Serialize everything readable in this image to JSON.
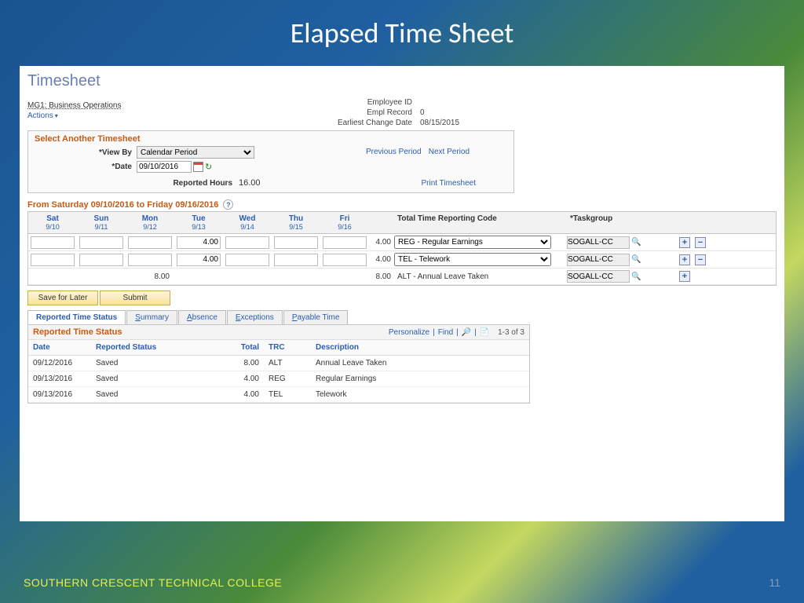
{
  "slide": {
    "title": "Elapsed Time Sheet",
    "org": "SOUTHERN CRESCENT TECHNICAL COLLEGE",
    "page": "11"
  },
  "app": {
    "title": "Timesheet",
    "employee_id_label": "Employee ID",
    "empl_record_label": "Empl Record",
    "empl_record": "0",
    "change_date_label": "Earliest Change Date",
    "change_date": "08/15/2015",
    "unit": "MG1: Business Operations",
    "actions": "Actions"
  },
  "select_panel": {
    "title": "Select Another Timesheet",
    "view_by_label": "*View By",
    "view_by": "Calendar Period",
    "date_label": "*Date",
    "date": "09/10/2016",
    "prev": "Previous Period",
    "next": "Next Period",
    "reported_hours_label": "Reported Hours",
    "reported_hours": "16.00",
    "print": "Print Timesheet"
  },
  "week": {
    "title": "From Saturday 09/10/2016 to Friday 09/16/2016",
    "days": [
      {
        "name": "Sat",
        "date": "9/10"
      },
      {
        "name": "Sun",
        "date": "9/11"
      },
      {
        "name": "Mon",
        "date": "9/12"
      },
      {
        "name": "Tue",
        "date": "9/13"
      },
      {
        "name": "Wed",
        "date": "9/14"
      },
      {
        "name": "Thu",
        "date": "9/15"
      },
      {
        "name": "Fri",
        "date": "9/16"
      }
    ],
    "trc_header": "Total Time Reporting Code",
    "tg_header": "*Taskgroup",
    "rows": [
      {
        "cells": [
          "",
          "",
          "",
          "4.00",
          "",
          "",
          ""
        ],
        "total": "4.00",
        "trc": "REG - Regular Earnings",
        "tg": "SOGALL-CC",
        "editable": true,
        "plus": true,
        "minus": true
      },
      {
        "cells": [
          "",
          "",
          "",
          "4.00",
          "",
          "",
          ""
        ],
        "total": "4.00",
        "trc": "TEL - Telework",
        "tg": "SOGALL-CC",
        "editable": true,
        "plus": true,
        "minus": true
      },
      {
        "cells": [
          "",
          "",
          "8.00",
          "",
          "",
          "",
          ""
        ],
        "total": "8.00",
        "trc": "ALT - Annual Leave Taken",
        "tg": "SOGALL-CC",
        "editable": false,
        "plus": true,
        "minus": false
      }
    ]
  },
  "buttons": {
    "save": "Save for Later",
    "submit": "Submit"
  },
  "tabs": {
    "items": [
      {
        "label": "Reported Time Status",
        "active": true
      },
      {
        "label": "Summary",
        "u": "S"
      },
      {
        "label": "Absence",
        "u": "A"
      },
      {
        "label": "Exceptions",
        "u": "E"
      },
      {
        "label": "Payable Time",
        "u": "P"
      }
    ]
  },
  "rts": {
    "title": "Reported Time Status",
    "personalize": "Personalize",
    "find": "Find",
    "count": "1-3 of 3",
    "cols": {
      "date": "Date",
      "status": "Reported Status",
      "total": "Total",
      "trc": "TRC",
      "desc": "Description"
    },
    "rows": [
      {
        "date": "09/12/2016",
        "status": "Saved",
        "total": "8.00",
        "trc": "ALT",
        "desc": "Annual Leave Taken"
      },
      {
        "date": "09/13/2016",
        "status": "Saved",
        "total": "4.00",
        "trc": "REG",
        "desc": "Regular Earnings"
      },
      {
        "date": "09/13/2016",
        "status": "Saved",
        "total": "4.00",
        "trc": "TEL",
        "desc": "Telework"
      }
    ]
  }
}
